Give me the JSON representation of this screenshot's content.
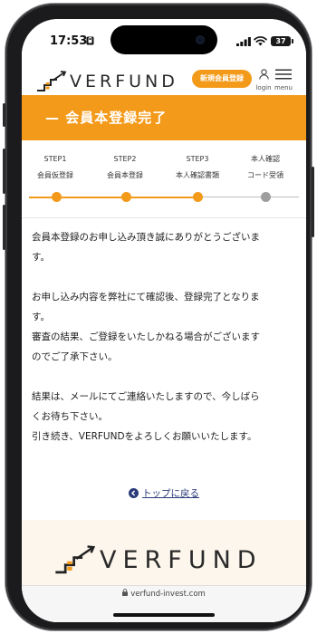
{
  "status_bar": {
    "time": "17:53",
    "battery": "37"
  },
  "header": {
    "logo_text": "VERFUND",
    "register_button": "新規会員登録",
    "login_label": "login",
    "menu_label": "menu"
  },
  "title": "— 会員本登録完了",
  "steps": [
    {
      "line1": "STEP1",
      "line2": "会員仮登録",
      "state": "done"
    },
    {
      "line1": "STEP2",
      "line2": "会員本登録",
      "state": "done"
    },
    {
      "line1": "STEP3",
      "line2": "本人確認書類",
      "state": "done"
    },
    {
      "line1": "本人確認",
      "line2": "コード受領",
      "state": "pending"
    }
  ],
  "colors": {
    "accent": "#f39a1a",
    "pending": "#9e9e9e",
    "link": "#2a3a78",
    "footer_bg": "#fdf6ec"
  },
  "content": {
    "p1_l1": "会員本登録のお申し込み頂き誠にありがとうございま",
    "p1_l2": "す。",
    "p2_l1": "お申し込み内容を弊社にて確認後、登録完了となりま",
    "p2_l2": "す。",
    "p2_l3": "審査の結果、ご登録をいたしかねる場合がございます",
    "p2_l4": "のでご了承下さい。",
    "p3_l1": "結果は、メールにてご連絡いたしますので、今しばら",
    "p3_l2": "くお待ち下さい。",
    "p3_l3": "引き続き、VERFUNDをよろしくお願いいたします。"
  },
  "back_link": "トップに戻る",
  "footer": {
    "logo_text": "VERFUND"
  },
  "browser": {
    "url": "verfund-invest.com"
  }
}
